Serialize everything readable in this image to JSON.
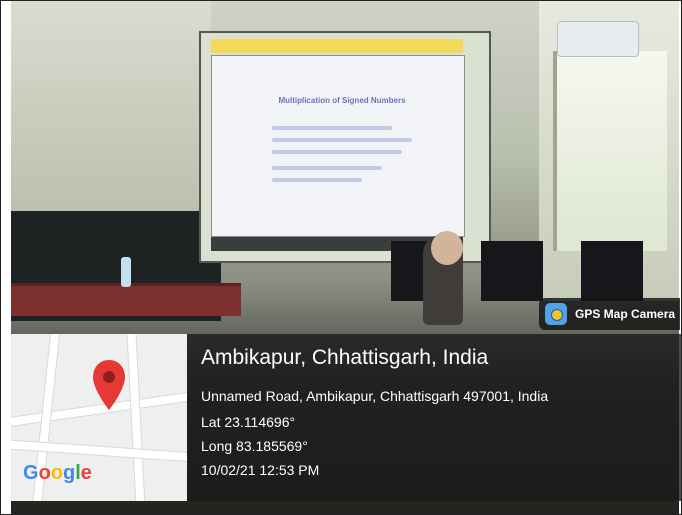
{
  "gps_badge": {
    "label": "GPS Map Camera",
    "icon": "camera-app-icon"
  },
  "location": {
    "title": "Ambikapur, Chhattisgarh, India",
    "address": "Unnamed Road, Ambikapur, Chhattisgarh 497001, India",
    "lat": "Lat 23.114696°",
    "long": "Long 83.185569°",
    "datetime": "10/02/21 12:53 PM"
  },
  "map": {
    "logo_letters": [
      "G",
      "o",
      "o",
      "g",
      "l",
      "e"
    ],
    "logo_colors": [
      "#4285F4",
      "#EA4335",
      "#FBBC05",
      "#4285F4",
      "#34A853",
      "#EA4335"
    ],
    "pin_color": "#E53935"
  },
  "slide": {
    "title": "Multiplication of Signed Numbers"
  }
}
